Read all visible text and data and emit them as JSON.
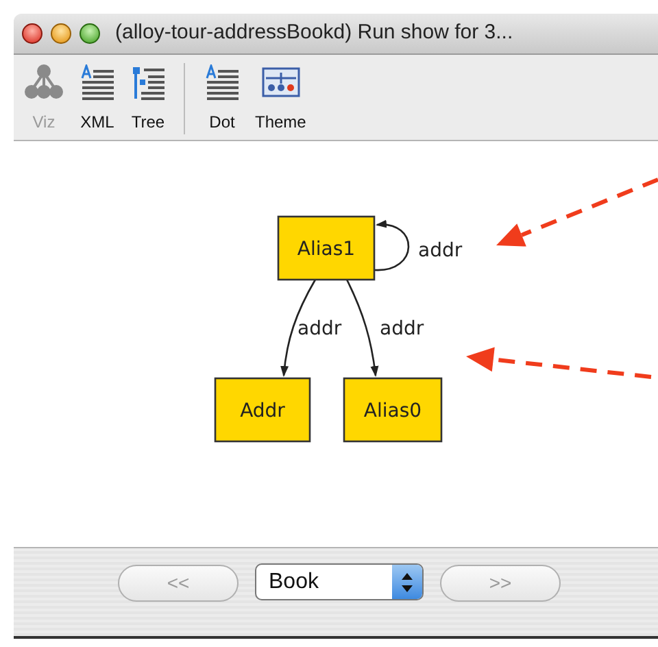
{
  "window": {
    "title": "(alloy-tour-addressBookd) Run show for 3..."
  },
  "toolbar": {
    "groups": [
      {
        "items": [
          {
            "label": "Viz",
            "kind": "viz",
            "disabled": true
          },
          {
            "label": "XML",
            "kind": "xml",
            "disabled": false
          },
          {
            "label": "Tree",
            "kind": "tree",
            "disabled": false
          }
        ]
      },
      {
        "items": [
          {
            "label": "Dot",
            "kind": "dot",
            "disabled": false
          },
          {
            "label": "Theme",
            "kind": "theme",
            "disabled": false
          }
        ]
      }
    ]
  },
  "graph": {
    "nodes": [
      {
        "label": "Alias1"
      },
      {
        "label": "Addr"
      },
      {
        "label": "Alias0"
      }
    ],
    "edges": [
      {
        "label": "addr",
        "kind": "loop"
      },
      {
        "label": "addr",
        "kind": "left"
      },
      {
        "label": "addr",
        "kind": "right"
      }
    ]
  },
  "navigation": {
    "previous": {
      "label": "<<",
      "disabled": true
    },
    "dropdown": {
      "value": "Book"
    },
    "next": {
      "label": ">>",
      "disabled": true
    }
  }
}
